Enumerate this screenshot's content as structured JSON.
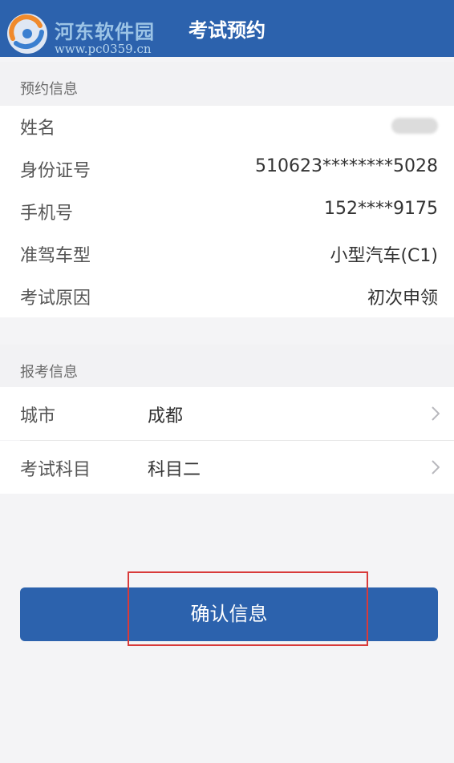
{
  "watermark": {
    "title": "河东软件园",
    "url": "www.pc0359.cn"
  },
  "header": {
    "title": "考试预约"
  },
  "booking_info": {
    "section_title": "预约信息",
    "rows": [
      {
        "label": "姓名",
        "value": ""
      },
      {
        "label": "身份证号",
        "value": "510623********5028"
      },
      {
        "label": "手机号",
        "value": "152****9175"
      },
      {
        "label": "准驾车型",
        "value": "小型汽车(C1)"
      },
      {
        "label": "考试原因",
        "value": "初次申领"
      }
    ]
  },
  "exam_info": {
    "section_title": "报考信息",
    "rows": [
      {
        "label": "城市",
        "value": "成都"
      },
      {
        "label": "考试科目",
        "value": "科目二"
      }
    ]
  },
  "confirm_button": {
    "label": "确认信息"
  },
  "colors": {
    "brand": "#2c62ad",
    "highlight": "#d83a3a",
    "background": "#f4f4f6"
  },
  "icons": {
    "row_chevron": "chevron-right-icon",
    "watermark_logo": "logo-icon"
  }
}
